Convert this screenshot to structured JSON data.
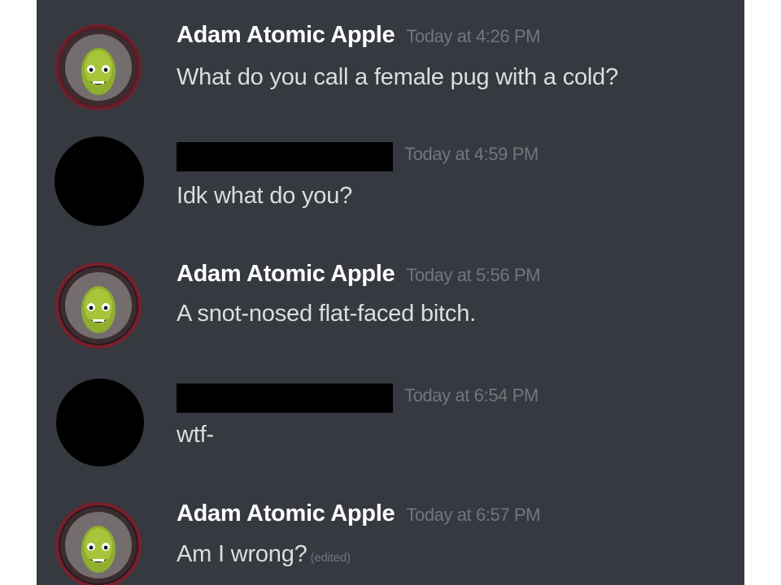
{
  "colors": {
    "background": "#36393f",
    "username": "#ffffff",
    "message_text": "#dcddde",
    "timestamp": "#72767d",
    "redaction": "#000000"
  },
  "messages": [
    {
      "author": "Adam Atomic Apple",
      "avatar_icon": "kerbal-avatar-icon",
      "timestamp": "Today at 4:26 PM",
      "text": "What do you call a female pug with a cold?"
    },
    {
      "author": "",
      "author_redacted": true,
      "avatar_icon": "redacted-avatar",
      "timestamp": "Today at 4:59 PM",
      "text": "Idk what do you?"
    },
    {
      "author": "Adam Atomic Apple",
      "avatar_icon": "kerbal-avatar-icon",
      "timestamp": "Today at 5:56 PM",
      "text": "A snot-nosed flat-faced bitch."
    },
    {
      "author": "",
      "author_redacted": true,
      "avatar_icon": "redacted-avatar",
      "timestamp": "Today at 6:54 PM",
      "text": "wtf-"
    },
    {
      "author": "Adam Atomic Apple",
      "avatar_icon": "kerbal-avatar-icon",
      "timestamp": "Today at 6:57 PM",
      "text": "Am I wrong?",
      "edited_label": "(edited)"
    }
  ]
}
